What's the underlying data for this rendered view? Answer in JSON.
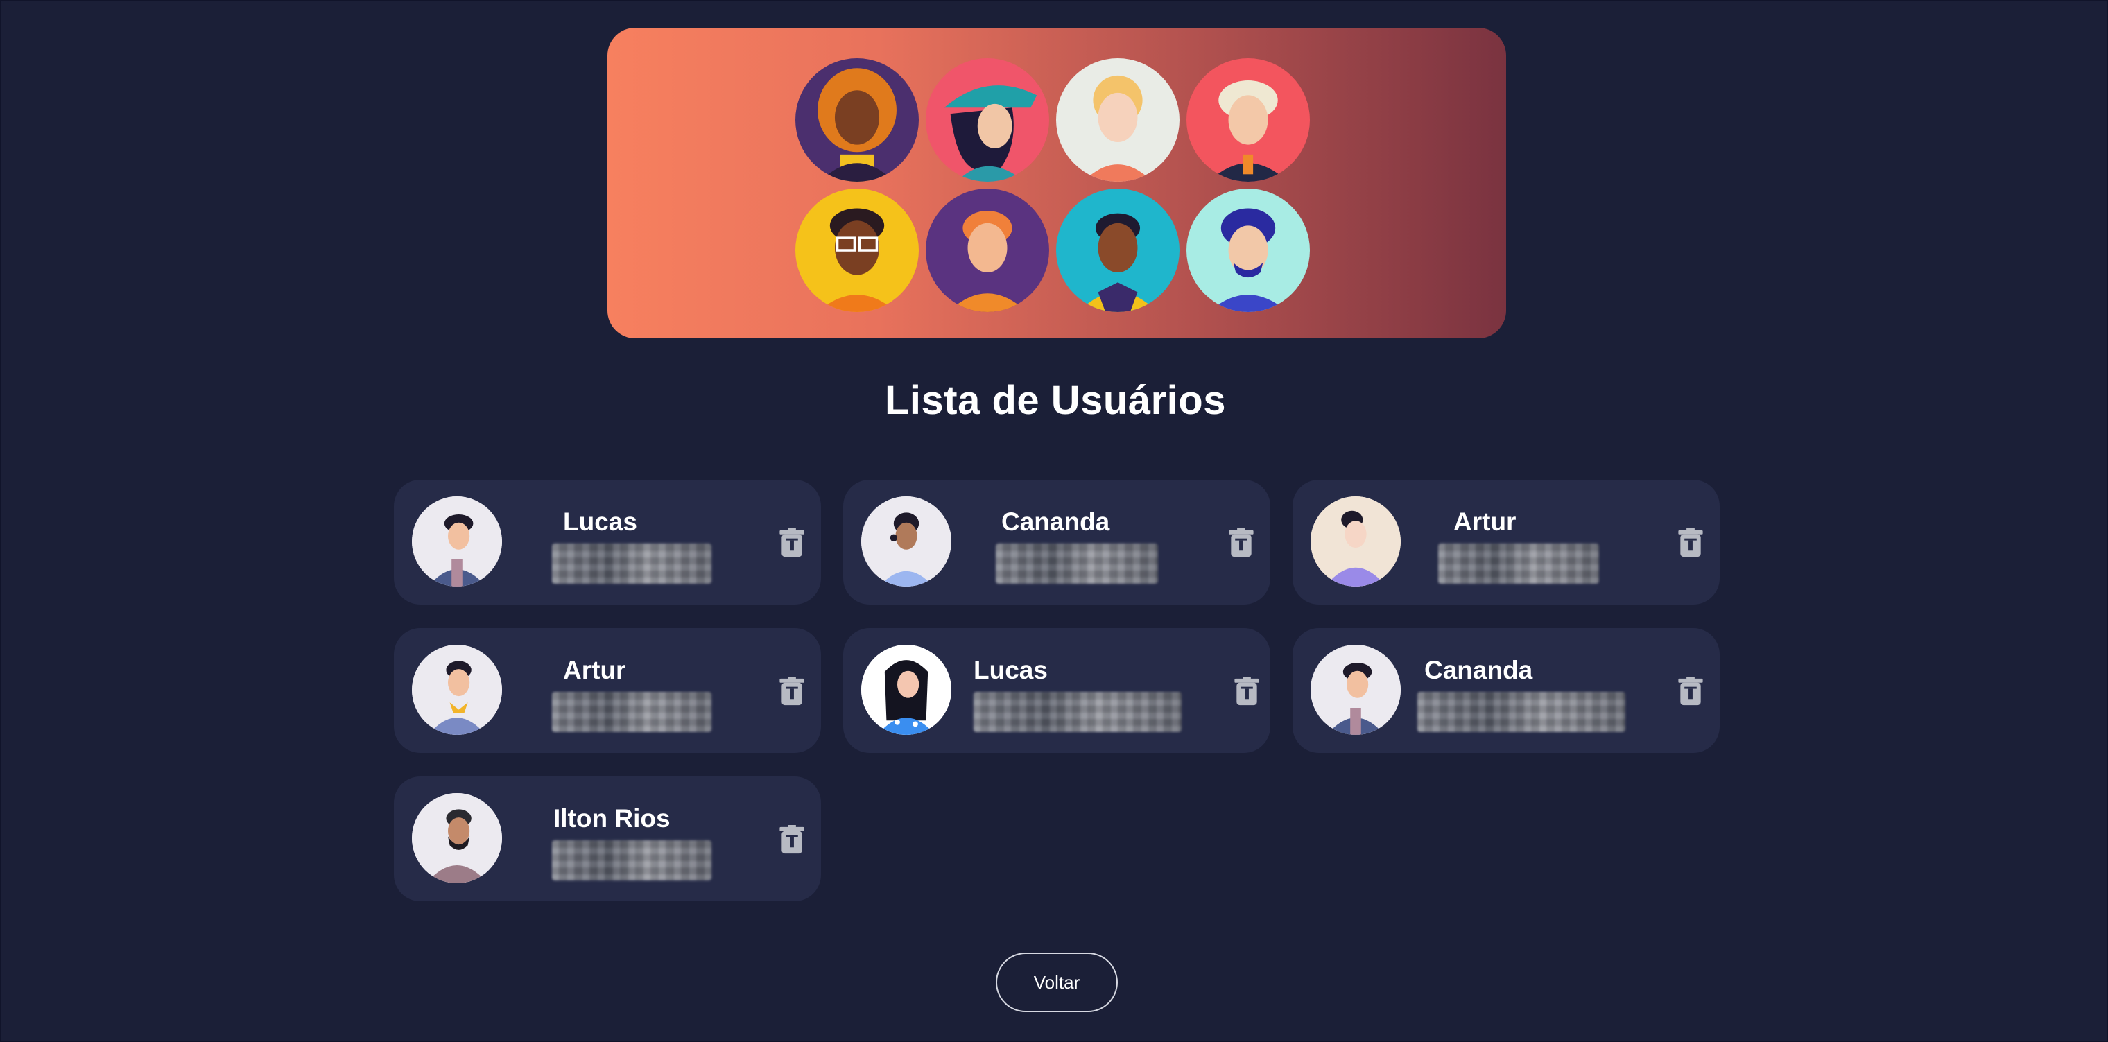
{
  "page": {
    "title": "Lista de Usuários",
    "back_label": "Voltar"
  },
  "banner": {
    "avatars": [
      "woman-curly-orange-hair",
      "woman-teal-hat",
      "woman-blonde-ponytail",
      "man-white-hair",
      "man-glasses",
      "man-ginger-hair",
      "man-yellow-jacket",
      "man-curly-blue-hair"
    ]
  },
  "users": [
    {
      "name": "Lucas",
      "avatar": "man-dark-hair-blue-shirt"
    },
    {
      "name": "Cananda",
      "avatar": "man-headset"
    },
    {
      "name": "Artur",
      "avatar": "woman-purple-hoodie"
    },
    {
      "name": "Artur",
      "avatar": "man-yellow-collar"
    },
    {
      "name": "Lucas",
      "avatar": "woman-long-black-hair"
    },
    {
      "name": "Cananda",
      "avatar": "man-dark-hair-blue-shirt"
    },
    {
      "name": "Ilton Rios",
      "avatar": "man-beard"
    }
  ],
  "icons": {
    "delete": "trash-icon"
  },
  "colors": {
    "background": "#1b1f37",
    "card": "#262b48",
    "banner_start": "#f7805f",
    "banner_end": "#7a3340",
    "text": "#ffffff"
  }
}
